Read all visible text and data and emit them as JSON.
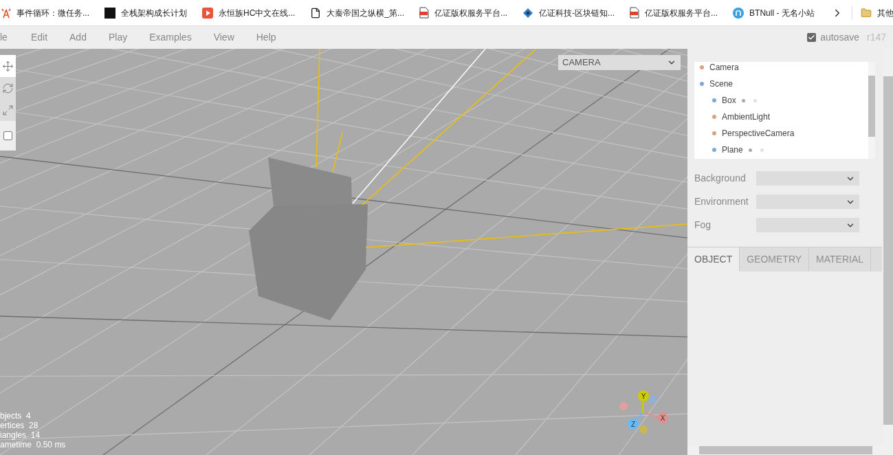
{
  "bookmarks": [
    {
      "kind": "tower",
      "label": "事件循环：微任务..."
    },
    {
      "kind": "square",
      "label": "全栈架构成长计划"
    },
    {
      "kind": "video",
      "label": "永恒族HC中文在线..."
    },
    {
      "kind": "page",
      "label": "大秦帝国之纵横_第..."
    },
    {
      "kind": "pdf",
      "label": "亿证版权服务平台..."
    },
    {
      "kind": "diamond",
      "label": "亿证科技-区块链知..."
    },
    {
      "kind": "pdf",
      "label": "亿证版权服务平台..."
    },
    {
      "kind": "circle",
      "label": "BTNull - 无名小站"
    }
  ],
  "bookmark_folder": {
    "label": "其他"
  },
  "menu": [
    "le",
    "Edit",
    "Add",
    "Play",
    "Examples",
    "View",
    "Help"
  ],
  "autosave": {
    "label": "autosave",
    "checked": true
  },
  "version": "r147",
  "toolbar": [
    {
      "kind": "translate",
      "selected": true
    },
    {
      "kind": "rotate",
      "selected": false
    },
    {
      "kind": "scale",
      "selected": false
    }
  ],
  "local_checkbox": {
    "checked": false
  },
  "camera_select": {
    "value": "CAMERA"
  },
  "info": [
    {
      "label": "bjects",
      "value": "4"
    },
    {
      "label": "ertices",
      "value": "28"
    },
    {
      "label": "iangles",
      "value": "14"
    },
    {
      "label": "ametime",
      "value": "0.50 ms"
    }
  ],
  "gizmo": {
    "y": "Y",
    "x": "X",
    "z": "Z"
  },
  "outliner": [
    {
      "name": "Camera",
      "color": "#e0a080"
    },
    {
      "name": "Scene",
      "color": "#80a8d8",
      "children": [
        {
          "name": "Box",
          "color": "#80a8d8",
          "kind": "mesh"
        },
        {
          "name": "AmbientLight",
          "color": "#e0a080"
        },
        {
          "name": "PerspectiveCamera",
          "color": "#e0a080"
        },
        {
          "name": "Plane",
          "color": "#80a8d8",
          "kind": "mesh"
        }
      ]
    }
  ],
  "scene_settings": [
    {
      "label": "Background"
    },
    {
      "label": "Environment"
    },
    {
      "label": "Fog"
    }
  ],
  "tabs": [
    {
      "label": "OBJECT",
      "selected": true
    },
    {
      "label": "GEOMETRY",
      "selected": false
    },
    {
      "label": "MATERIAL",
      "selected": false
    }
  ]
}
